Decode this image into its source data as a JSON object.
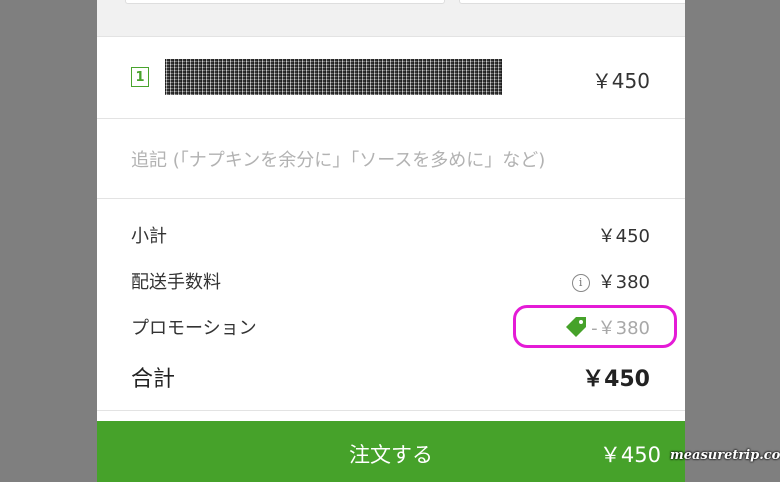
{
  "cart_item": {
    "quantity": "1",
    "price": "￥450"
  },
  "note": {
    "placeholder": "追記 (「ナプキンを余分に」「ソースを多めに」など)"
  },
  "summary": {
    "subtotal_label": "小計",
    "subtotal_value": "￥450",
    "delivery_label": "配送手数料",
    "delivery_value": "￥380",
    "delivery_icon": "info-icon",
    "promo_label": "プロモーション",
    "promo_value": "-￥380",
    "promo_icon": "tag-icon",
    "total_label": "合計",
    "total_value": "￥450"
  },
  "order_button": {
    "label": "注文する",
    "price": "￥450"
  },
  "watermark": "measuretrip.com",
  "colors": {
    "brand_green": "#46a22a",
    "highlight": "#e41bd6"
  }
}
